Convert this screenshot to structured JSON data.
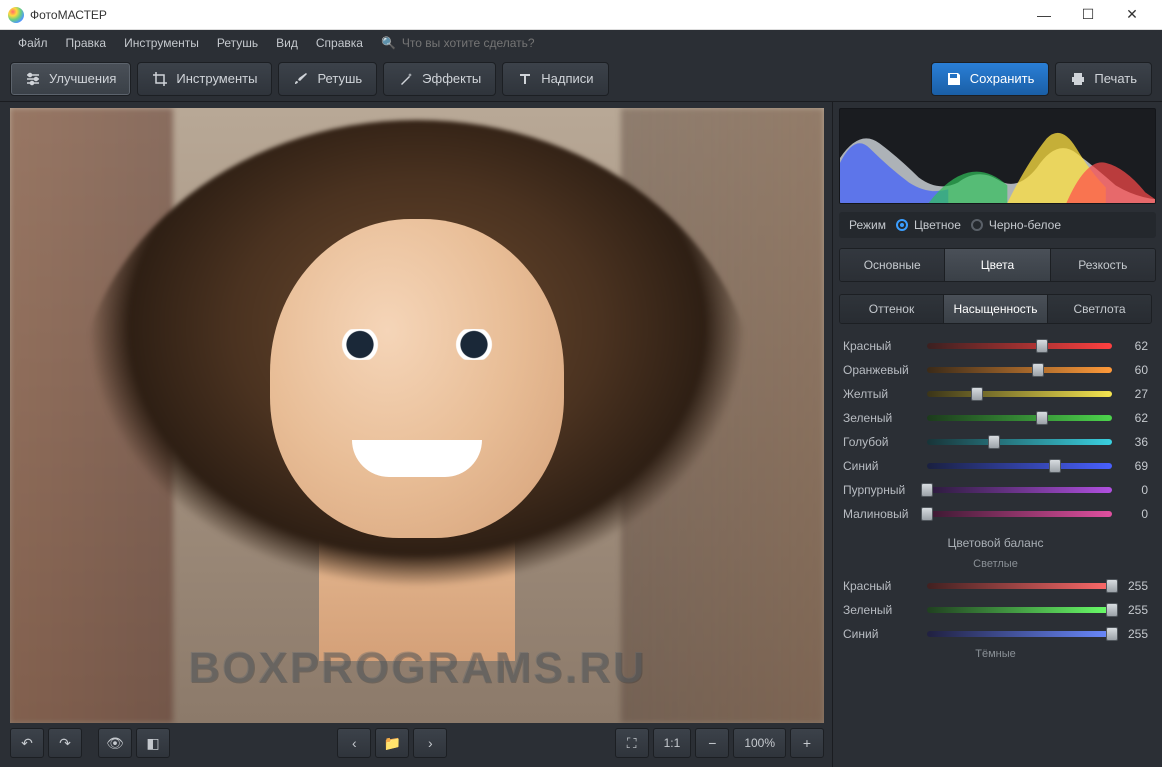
{
  "window": {
    "title": "ФотоМАСТЕР"
  },
  "menu": {
    "file": "Файл",
    "edit": "Правка",
    "tools": "Инструменты",
    "retouch": "Ретушь",
    "view": "Вид",
    "help": "Справка",
    "search_placeholder": "Что вы хотите сделать?"
  },
  "toolbar": {
    "enhance": "Улучшения",
    "tools": "Инструменты",
    "retouch": "Ретушь",
    "effects": "Эффекты",
    "text": "Надписи",
    "save": "Сохранить",
    "print": "Печать"
  },
  "bottombar": {
    "ratio": "1:1",
    "zoom": "100%"
  },
  "side": {
    "mode_label": "Режим",
    "mode_color": "Цветное",
    "mode_bw": "Черно-белое",
    "tabs": {
      "basic": "Основные",
      "colors": "Цвета",
      "sharp": "Резкость"
    },
    "subtabs": {
      "hue": "Оттенок",
      "saturation": "Насыщенность",
      "luminance": "Светлота"
    },
    "sliders": [
      {
        "label": "Красный",
        "value": 62,
        "grad": "linear-gradient(90deg,#3a2020,#ff4040)"
      },
      {
        "label": "Оранжевый",
        "value": 60,
        "grad": "linear-gradient(90deg,#3a2a18,#ff9a3a)"
      },
      {
        "label": "Желтый",
        "value": 27,
        "grad": "linear-gradient(90deg,#3a3418,#f5e550)"
      },
      {
        "label": "Зеленый",
        "value": 62,
        "grad": "linear-gradient(90deg,#1c3a1c,#4cd44c)"
      },
      {
        "label": "Голубой",
        "value": 36,
        "grad": "linear-gradient(90deg,#183438,#3ad0e0)"
      },
      {
        "label": "Синий",
        "value": 69,
        "grad": "linear-gradient(90deg,#1a2040,#4860ff)"
      },
      {
        "label": "Пурпурный",
        "value": 0,
        "grad": "linear-gradient(90deg,#2a1a3a,#b050e0)"
      },
      {
        "label": "Малиновый",
        "value": 0,
        "grad": "linear-gradient(90deg,#3a1830,#e050a0)"
      }
    ],
    "balance_title": "Цветовой баланс",
    "balance_light": "Светлые",
    "balance_dark": "Тёмные",
    "balance_sliders": [
      {
        "label": "Красный",
        "value": 255,
        "grad": "linear-gradient(90deg,#402020,#ff6a6a)"
      },
      {
        "label": "Зеленый",
        "value": 255,
        "grad": "linear-gradient(90deg,#204020,#6aff6a)"
      },
      {
        "label": "Синий",
        "value": 255,
        "grad": "linear-gradient(90deg,#202040,#6a8aff)"
      }
    ]
  },
  "watermark": "BOXPROGRAMS.RU"
}
